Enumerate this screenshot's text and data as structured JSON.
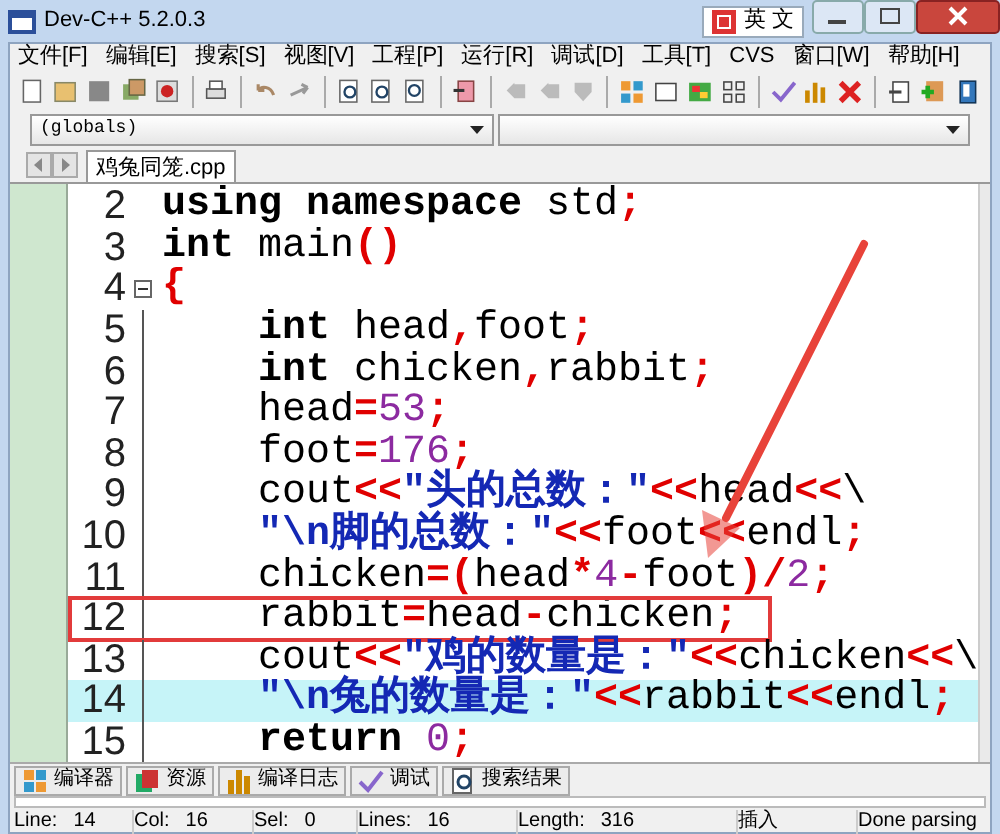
{
  "window": {
    "title": "Dev-C++ 5.2.0.3",
    "ime": "英 文"
  },
  "menu": [
    "文件[F]",
    "编辑[E]",
    "搜索[S]",
    "视图[V]",
    "工程[P]",
    "运行[R]",
    "调试[D]",
    "工具[T]",
    "CVS",
    "窗口[W]",
    "帮助[H]"
  ],
  "scope_selector": {
    "value": "(globals)"
  },
  "file_tabs": [
    {
      "label": "鸡兔同笼.cpp",
      "selected": true
    }
  ],
  "lines": [
    {
      "number": "2",
      "fold_toggle": false,
      "in_fold": false,
      "highlighted": false,
      "boxed": false,
      "tokens": [
        {
          "kind": "kw",
          "text": "using namespace"
        },
        {
          "kind": "id",
          "text": " std"
        },
        {
          "kind": "sym",
          "text": ";"
        }
      ]
    },
    {
      "number": "3",
      "fold_toggle": false,
      "in_fold": false,
      "highlighted": false,
      "boxed": false,
      "tokens": [
        {
          "kind": "kw",
          "text": "int"
        },
        {
          "kind": "id",
          "text": " main"
        },
        {
          "kind": "sym",
          "text": "()"
        }
      ]
    },
    {
      "number": "4",
      "fold_toggle": true,
      "in_fold": false,
      "highlighted": false,
      "boxed": false,
      "tokens": [
        {
          "kind": "sym",
          "text": "{"
        }
      ]
    },
    {
      "number": "5",
      "fold_toggle": false,
      "in_fold": true,
      "highlighted": false,
      "boxed": false,
      "tokens": [
        {
          "kind": "kw",
          "text": "    int"
        },
        {
          "kind": "id",
          "text": " head"
        },
        {
          "kind": "sym",
          "text": ","
        },
        {
          "kind": "id",
          "text": "foot"
        },
        {
          "kind": "sym",
          "text": ";"
        }
      ]
    },
    {
      "number": "6",
      "fold_toggle": false,
      "in_fold": true,
      "highlighted": false,
      "boxed": false,
      "tokens": [
        {
          "kind": "kw",
          "text": "    int"
        },
        {
          "kind": "id",
          "text": " chicken"
        },
        {
          "kind": "sym",
          "text": ","
        },
        {
          "kind": "id",
          "text": "rabbit"
        },
        {
          "kind": "sym",
          "text": ";"
        }
      ]
    },
    {
      "number": "7",
      "fold_toggle": false,
      "in_fold": true,
      "highlighted": false,
      "boxed": false,
      "tokens": [
        {
          "kind": "id",
          "text": "    head"
        },
        {
          "kind": "sym",
          "text": "="
        },
        {
          "kind": "num",
          "text": "53"
        },
        {
          "kind": "sym",
          "text": ";"
        }
      ]
    },
    {
      "number": "8",
      "fold_toggle": false,
      "in_fold": true,
      "highlighted": false,
      "boxed": false,
      "tokens": [
        {
          "kind": "id",
          "text": "    foot"
        },
        {
          "kind": "sym",
          "text": "="
        },
        {
          "kind": "num",
          "text": "176"
        },
        {
          "kind": "sym",
          "text": ";"
        }
      ]
    },
    {
      "number": "9",
      "fold_toggle": false,
      "in_fold": true,
      "highlighted": false,
      "boxed": false,
      "tokens": [
        {
          "kind": "id",
          "text": "    cout"
        },
        {
          "kind": "sym",
          "text": "<<"
        },
        {
          "kind": "str",
          "text": "\"头的总数：\""
        },
        {
          "kind": "sym",
          "text": "<<"
        },
        {
          "kind": "id",
          "text": "head"
        },
        {
          "kind": "sym",
          "text": "<<"
        },
        {
          "kind": "id",
          "text": "\\"
        }
      ]
    },
    {
      "number": "10",
      "fold_toggle": false,
      "in_fold": true,
      "highlighted": false,
      "boxed": false,
      "tokens": [
        {
          "kind": "str",
          "text": "    \"\\n脚的总数：\""
        },
        {
          "kind": "sym",
          "text": "<<"
        },
        {
          "kind": "id",
          "text": "foot"
        },
        {
          "kind": "sym",
          "text": "<<"
        },
        {
          "kind": "id",
          "text": "endl"
        },
        {
          "kind": "sym",
          "text": ";"
        }
      ]
    },
    {
      "number": "11",
      "fold_toggle": false,
      "in_fold": true,
      "highlighted": false,
      "boxed": false,
      "tokens": [
        {
          "kind": "id",
          "text": "    chicken"
        },
        {
          "kind": "sym",
          "text": "=("
        },
        {
          "kind": "id",
          "text": "head"
        },
        {
          "kind": "sym",
          "text": "*"
        },
        {
          "kind": "num",
          "text": "4"
        },
        {
          "kind": "sym",
          "text": "-"
        },
        {
          "kind": "id",
          "text": "foot"
        },
        {
          "kind": "sym",
          "text": ")/"
        },
        {
          "kind": "num",
          "text": "2"
        },
        {
          "kind": "sym",
          "text": ";"
        }
      ]
    },
    {
      "number": "12",
      "fold_toggle": false,
      "in_fold": true,
      "highlighted": false,
      "boxed": true,
      "tokens": [
        {
          "kind": "id",
          "text": "    rabbit"
        },
        {
          "kind": "sym",
          "text": "="
        },
        {
          "kind": "id",
          "text": "head"
        },
        {
          "kind": "sym",
          "text": "-"
        },
        {
          "kind": "id",
          "text": "chicken"
        },
        {
          "kind": "sym",
          "text": ";"
        }
      ]
    },
    {
      "number": "13",
      "fold_toggle": false,
      "in_fold": true,
      "highlighted": false,
      "boxed": false,
      "tokens": [
        {
          "kind": "id",
          "text": "    cout"
        },
        {
          "kind": "sym",
          "text": "<<"
        },
        {
          "kind": "str",
          "text": "\"鸡的数量是：\""
        },
        {
          "kind": "sym",
          "text": "<<"
        },
        {
          "kind": "id",
          "text": "chicken"
        },
        {
          "kind": "sym",
          "text": "<<"
        },
        {
          "kind": "id",
          "text": "\\"
        }
      ]
    },
    {
      "number": "14",
      "fold_toggle": false,
      "in_fold": true,
      "highlighted": true,
      "boxed": false,
      "tokens": [
        {
          "kind": "str",
          "text": "    \"\\n兔的数量是：\""
        },
        {
          "kind": "sym",
          "text": "<<"
        },
        {
          "kind": "id",
          "text": "rabbit"
        },
        {
          "kind": "sym",
          "text": "<<"
        },
        {
          "kind": "id",
          "text": "endl"
        },
        {
          "kind": "sym",
          "text": ";"
        }
      ]
    },
    {
      "number": "15",
      "fold_toggle": false,
      "in_fold": true,
      "highlighted": false,
      "boxed": false,
      "tokens": [
        {
          "kind": "kw",
          "text": "    return"
        },
        {
          "kind": "num",
          "text": " 0"
        },
        {
          "kind": "sym",
          "text": ";"
        }
      ]
    }
  ],
  "bottom_tabs": [
    {
      "label": "编译器"
    },
    {
      "label": "资源"
    },
    {
      "label": "编译日志"
    },
    {
      "label": "调试"
    },
    {
      "label": "搜索结果"
    }
  ],
  "status_bar": [
    {
      "label": "Line:",
      "value": "14"
    },
    {
      "label": "Col:",
      "value": "16"
    },
    {
      "label": "Sel:",
      "value": "0"
    },
    {
      "label": "Lines:",
      "value": "16"
    },
    {
      "label": "Length:",
      "value": "316"
    },
    {
      "value": "插入"
    },
    {
      "value": "Done parsing"
    }
  ]
}
